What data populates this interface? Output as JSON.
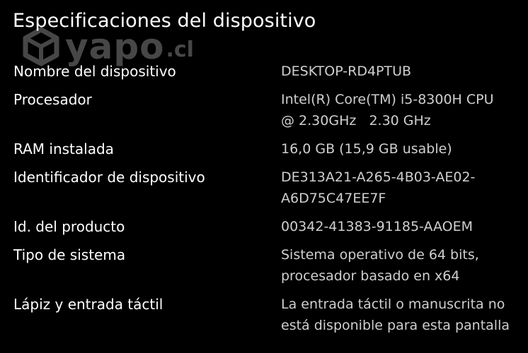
{
  "header": {
    "title": "Especificaciones del dispositivo"
  },
  "watermark": {
    "brand": "yapo",
    "suffix": ".cl",
    "icon": "box-logo-icon"
  },
  "specs": [
    {
      "label": "Nombre del dispositivo",
      "lines": [
        "DESKTOP-RD4PTUB"
      ]
    },
    {
      "label": "Procesador",
      "lines": [
        "Intel(R) Core(TM) i5-8300H CPU",
        "@ 2.30GHz   2.30 GHz"
      ]
    },
    {
      "label": "RAM instalada",
      "lines": [
        "16,0 GB (15,9 GB usable)"
      ]
    },
    {
      "label": "Identificador de dispositivo",
      "lines": [
        "DE313A21-A265-4B03-AE02-",
        "A6D75C47EE7F"
      ]
    },
    {
      "label": "Id. del producto",
      "lines": [
        "00342-41383-91185-AAOEM"
      ]
    },
    {
      "label": "Tipo de sistema",
      "lines": [
        "Sistema operativo de 64 bits,",
        "procesador basado en x64"
      ]
    },
    {
      "label": "Lápiz y entrada táctil",
      "lines": [
        "La entrada táctil o manuscrita no",
        "está disponible para esta pantalla"
      ]
    }
  ],
  "colors": {
    "background": "#000000",
    "label": "#ffffff",
    "value": "#cfcfcf"
  }
}
